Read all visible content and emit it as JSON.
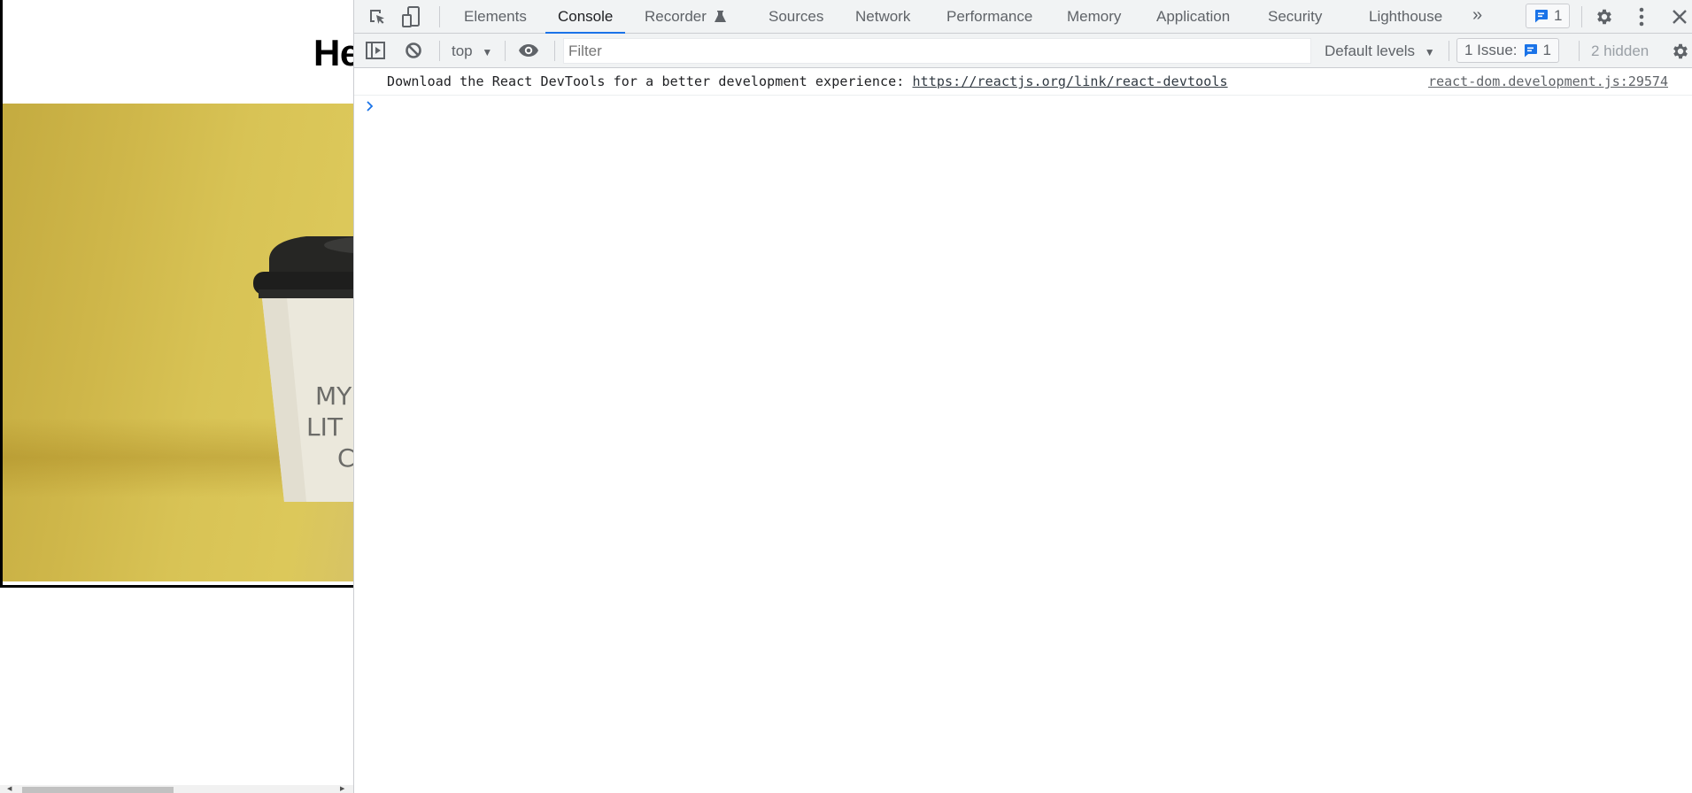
{
  "page": {
    "heading": "He",
    "hero_image_alt": "yellow background with white coffee cup",
    "cup_text": [
      "MY",
      "LIT",
      "C"
    ]
  },
  "devtools": {
    "tabs": [
      {
        "label": "Elements",
        "active": false
      },
      {
        "label": "Console",
        "active": true
      },
      {
        "label": "Recorder",
        "active": false,
        "icon": "flask-icon"
      },
      {
        "label": "Sources",
        "active": false
      },
      {
        "label": "Network",
        "active": false
      },
      {
        "label": "Performance",
        "active": false
      },
      {
        "label": "Memory",
        "active": false
      },
      {
        "label": "Application",
        "active": false
      },
      {
        "label": "Security",
        "active": false
      },
      {
        "label": "Lighthouse",
        "active": false
      }
    ],
    "more_tabs_label": "»",
    "issues_badge_count": "1",
    "toolbar": {
      "context": "top",
      "filter_placeholder": "Filter",
      "filter_value": "",
      "levels": "Default levels",
      "issues_label": "1 Issue:",
      "issues_count": "1",
      "hidden_label": "2 hidden"
    },
    "console": {
      "messages": [
        {
          "text": "Download the React DevTools for a better development experience: ",
          "link": "https://reactjs.org/link/react-devtools",
          "source": "react-dom.development.js:29574"
        }
      ],
      "prompt": "›"
    },
    "colors": {
      "accent": "#1a73e8",
      "toolbar_bg": "#f1f3f4",
      "border": "#cbcdd1",
      "text_muted": "#5f6368",
      "hero_yellow": "#d6c050"
    }
  }
}
